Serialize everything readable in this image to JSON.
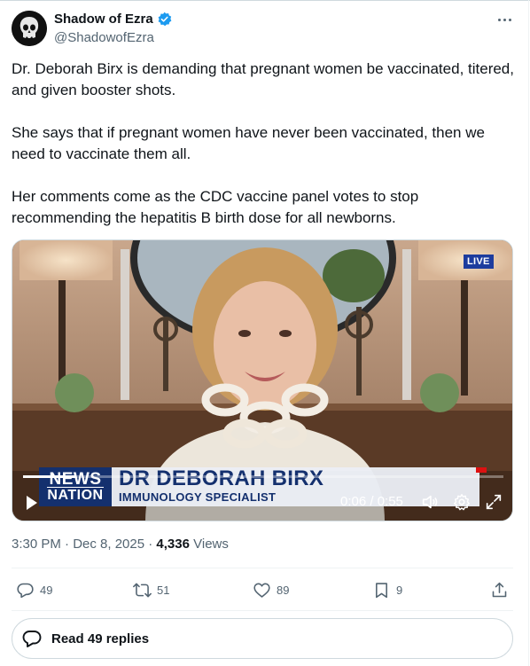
{
  "author": {
    "display_name": "Shadow of Ezra",
    "handle": "@ShadowofEzra",
    "verified": true
  },
  "tweet": {
    "paragraphs": [
      "Dr. Deborah Birx is demanding that pregnant women be vaccinated, titered, and given booster shots.",
      "She says that if pregnant women have never been vaccinated, then we need to vaccinate them all.",
      "Her comments come as the CDC vaccine panel votes to stop recommending the hepatitis B birth dose for all newborns."
    ]
  },
  "video": {
    "live_badge": "LIVE",
    "network_logo_line1": "NEWS",
    "network_logo_line2": "NATION",
    "lower_third_name": "DR DEBORAH BIRX",
    "lower_third_title": "IMMUNOLOGY SPECIALIST",
    "time_display": "0:06 / 0:55",
    "progress_fraction": 0.11
  },
  "meta": {
    "timestamp": "3:30 PM · Dec 8, 2025 · ",
    "views_count": "4,336",
    "views_label": " Views"
  },
  "actions": {
    "replies": "49",
    "reposts": "51",
    "likes": "89",
    "bookmarks": "9"
  },
  "read_replies_label": "Read 49 replies",
  "colors": {
    "verified_blue": "#1d9bf0",
    "secondary_text": "#536471",
    "primary_text": "#0f1419",
    "newsnation_navy": "#14306e"
  }
}
